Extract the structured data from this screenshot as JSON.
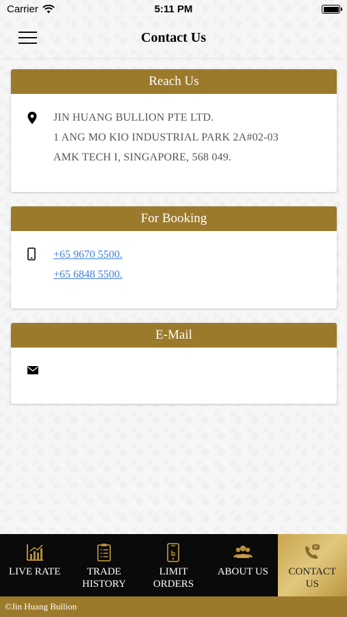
{
  "status_bar": {
    "carrier": "Carrier",
    "time": "5:11 PM"
  },
  "header": {
    "title": "Contact Us"
  },
  "reach_us": {
    "title": "Reach Us",
    "lines": [
      "JIN HUANG BULLION PTE LTD.",
      "1 ANG MO KIO INDUSTRIAL PARK 2A#02-03",
      "AMK TECH I, SINGAPORE, 568 049."
    ]
  },
  "booking": {
    "title": "For Booking",
    "phones": [
      "+65 9670 5500.",
      "+65 6848 5500."
    ]
  },
  "email": {
    "title": "E-Mail",
    "address": ""
  },
  "tabs": [
    {
      "label_1": "LIVE RATE",
      "label_2": "",
      "icon": "bar-chart-icon"
    },
    {
      "label_1": "TRADE",
      "label_2": "HISTORY",
      "icon": "clipboard-list-icon"
    },
    {
      "label_1": "LIMIT",
      "label_2": "ORDERS",
      "icon": "phone-order-icon"
    },
    {
      "label_1": "ABOUT US",
      "label_2": "",
      "icon": "people-icon"
    },
    {
      "label_1": "CONTACT",
      "label_2": "US",
      "icon": "contact-phone-icon"
    }
  ],
  "footer": {
    "text": "©Jin Huang Bullion"
  },
  "colors": {
    "accent": "#9b7a2c",
    "link": "#3d7fe0",
    "tab_bar": "#0a0a0a"
  }
}
